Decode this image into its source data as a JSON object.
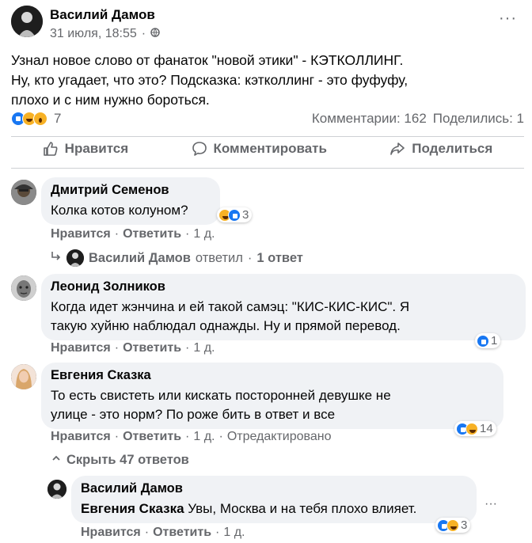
{
  "post": {
    "author": "Василий Дамов",
    "date": "31 июля, 18:55",
    "visibility_sep": "·",
    "more_label": "···",
    "text_lines": [
      "Узнал новое слово от фанаток \"новой этики\" - КЭТКОЛЛИНГ.",
      "Ну, кто угадает, что это? Подсказка: кэтколлинг - это фуфуфу,",
      "плохо и с ним нужно бороться."
    ],
    "reaction_count": "7",
    "comments_count": "Комментарии: 162",
    "shares_count": "Поделились: 1"
  },
  "actions": {
    "like": "Нравится",
    "comment": "Комментировать",
    "share": "Поделиться"
  },
  "comments": [
    {
      "author": "Дмитрий Семенов",
      "text_lines": [
        "Колка котов колуном?"
      ],
      "reaction_count": "3",
      "like": "Нравится",
      "reply": "Ответить",
      "time": "1 д.",
      "reply_thread": {
        "author": "Василий Дамов",
        "action": "ответил",
        "count": "1 ответ"
      }
    },
    {
      "author": "Леонид Золников",
      "text_lines": [
        "Когда идет жэнчина и ей такой самэц: \"КИС-КИС-КИС\". Я",
        "такую хуйню наблюдал однажды. Ну и прямой перевод."
      ],
      "reaction_count": "1",
      "like": "Нравится",
      "reply": "Ответить",
      "time": "1 д."
    },
    {
      "author": "Евгения Сказка",
      "text_lines": [
        "То есть свистеть или кискать посторонней девушке не",
        "улице - это норм? По роже бить в ответ и все"
      ],
      "reaction_count": "14",
      "like": "Нравится",
      "reply": "Ответить",
      "time": "1 д.",
      "edited": "Отредактировано",
      "hide_replies": "Скрыть 47 ответов"
    }
  ],
  "reply": {
    "author": "Василий Дамов",
    "mention": "Евгения Сказка",
    "text": "Увы, Москва и на тебя плохо влияет.",
    "reaction_count": "3",
    "like": "Нравится",
    "reply": "Ответить",
    "time": "1 д.",
    "more_label": "···"
  },
  "colors": {
    "muted": "#65676b",
    "bubble": "#f0f2f5",
    "like_blue": "#1877f2",
    "emoji_yellow": "#f7b125"
  }
}
